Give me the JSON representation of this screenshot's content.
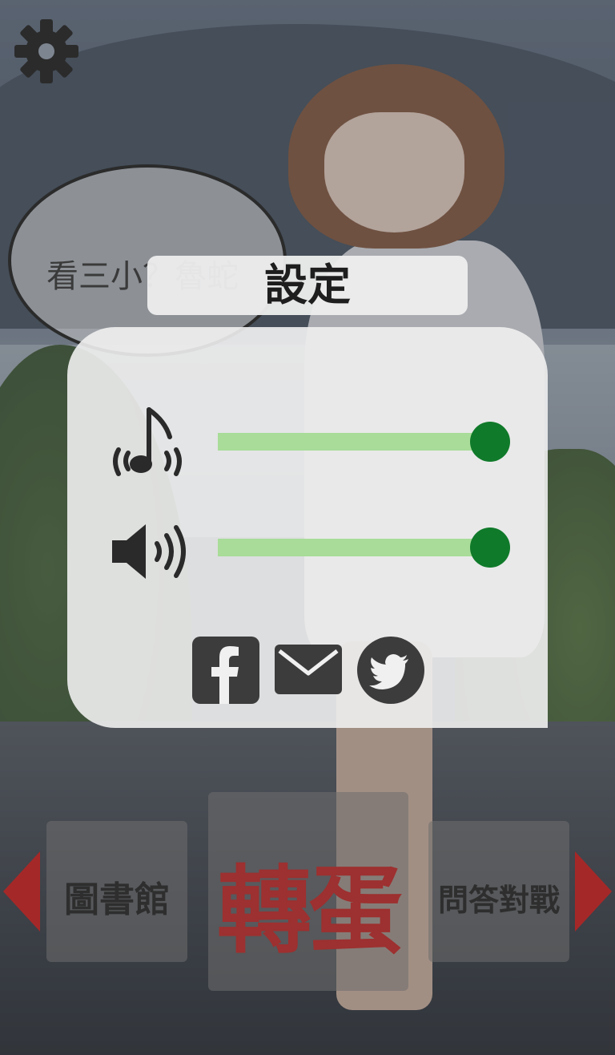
{
  "settings_dialog": {
    "title": "設定",
    "music_volume": 1.0,
    "sfx_volume": 1.0,
    "share": [
      "facebook-icon",
      "mail-icon",
      "twitter-icon"
    ]
  },
  "speech_bubble": {
    "text": "看三小？魯蛇"
  },
  "bottom_nav": {
    "library_label": "圖書館",
    "gacha_label": "轉蛋",
    "quiz_battle_label": "問答對戰"
  },
  "colors": {
    "slider_track": "#a8dc98",
    "slider_knob": "#0f7a2a",
    "nav_arrow": "#a52828",
    "gacha_text": "#9d3030"
  },
  "icons": {
    "settings": "gear-icon",
    "music": "music-note-icon",
    "sfx": "speaker-icon",
    "prev": "left-arrow-icon",
    "next": "right-arrow-icon"
  }
}
